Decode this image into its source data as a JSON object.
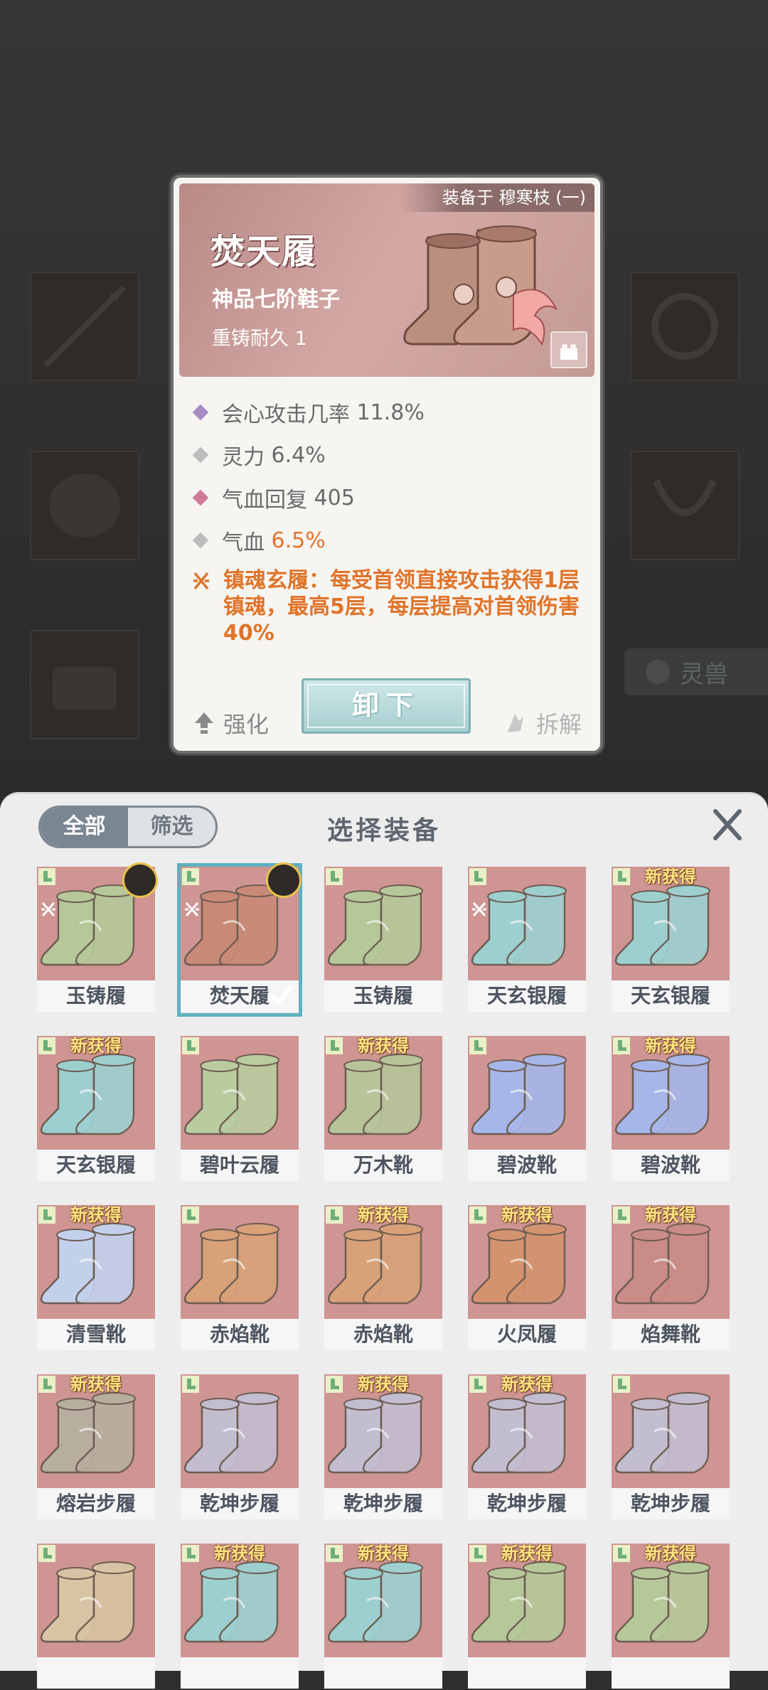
{
  "background": {
    "side_tab_label": "灵兽"
  },
  "detail": {
    "equipped_label": "装备于 穆寒枝 (一)",
    "name": "焚天履",
    "grade": "神品七阶鞋子",
    "reforge": "重铸耐久 1",
    "stats": [
      {
        "label": "会心攻击几率",
        "value": "11.8%",
        "diamond_color": "#a68ac4",
        "value_highlight": false
      },
      {
        "label": "灵力",
        "value": "6.4%",
        "diamond_color": "#bdbdbd",
        "value_highlight": false
      },
      {
        "label": "气血回复",
        "value": "405",
        "diamond_color": "#cf7b99",
        "value_highlight": false
      },
      {
        "label": "气血",
        "value": "6.5%",
        "diamond_color": "#bdbdbd",
        "value_highlight": true
      }
    ],
    "special_effect": "镇魂玄履：每受首领直接攻击获得1层镇魂，最高5层，每层提高对首领伤害40%",
    "enhance_label": "强化",
    "unequip_label": "卸下",
    "dismantle_label": "拆解"
  },
  "panel": {
    "title": "选择装备",
    "tabs": [
      {
        "label": "全部",
        "active": true
      },
      {
        "label": "筛选",
        "active": false
      }
    ],
    "new_badge": "新获得",
    "items": [
      {
        "name": "玉铸履",
        "is_new": false,
        "set_icon": true,
        "avatar": true,
        "selected": false,
        "tint": "#b6c89a"
      },
      {
        "name": "焚天履",
        "is_new": false,
        "set_icon": true,
        "avatar": true,
        "selected": true,
        "tint": "#c98a77"
      },
      {
        "name": "玉铸履",
        "is_new": false,
        "set_icon": false,
        "avatar": false,
        "selected": false,
        "tint": "#b6c89a"
      },
      {
        "name": "天玄银履",
        "is_new": false,
        "set_icon": true,
        "avatar": false,
        "selected": false,
        "tint": "#9ecfcf"
      },
      {
        "name": "天玄银履",
        "is_new": true,
        "set_icon": false,
        "avatar": false,
        "selected": false,
        "tint": "#9ecfcf"
      },
      {
        "name": "天玄银履",
        "is_new": true,
        "set_icon": false,
        "avatar": false,
        "selected": false,
        "tint": "#9ecfcf"
      },
      {
        "name": "碧叶云履",
        "is_new": false,
        "set_icon": false,
        "avatar": false,
        "selected": false,
        "tint": "#b9cc9f"
      },
      {
        "name": "万木靴",
        "is_new": true,
        "set_icon": false,
        "avatar": false,
        "selected": false,
        "tint": "#b7c49a"
      },
      {
        "name": "碧波靴",
        "is_new": false,
        "set_icon": false,
        "avatar": false,
        "selected": false,
        "tint": "#a6b6e8"
      },
      {
        "name": "碧波靴",
        "is_new": true,
        "set_icon": false,
        "avatar": false,
        "selected": false,
        "tint": "#a6b6e8"
      },
      {
        "name": "清雪靴",
        "is_new": true,
        "set_icon": false,
        "avatar": false,
        "selected": false,
        "tint": "#c2d0ec"
      },
      {
        "name": "赤焰靴",
        "is_new": false,
        "set_icon": false,
        "avatar": false,
        "selected": false,
        "tint": "#d8a178"
      },
      {
        "name": "赤焰靴",
        "is_new": true,
        "set_icon": false,
        "avatar": false,
        "selected": false,
        "tint": "#d8a178"
      },
      {
        "name": "火凤履",
        "is_new": true,
        "set_icon": false,
        "avatar": false,
        "selected": false,
        "tint": "#d4936f"
      },
      {
        "name": "焰舞靴",
        "is_new": true,
        "set_icon": false,
        "avatar": false,
        "selected": false,
        "tint": "#c98c86"
      },
      {
        "name": "熔岩步履",
        "is_new": true,
        "set_icon": false,
        "avatar": false,
        "selected": false,
        "tint": "#b7aea0"
      },
      {
        "name": "乾坤步履",
        "is_new": false,
        "set_icon": false,
        "avatar": false,
        "selected": false,
        "tint": "#c3bdd0"
      },
      {
        "name": "乾坤步履",
        "is_new": true,
        "set_icon": false,
        "avatar": false,
        "selected": false,
        "tint": "#c3bdd0"
      },
      {
        "name": "乾坤步履",
        "is_new": true,
        "set_icon": false,
        "avatar": false,
        "selected": false,
        "tint": "#c3bdd0"
      },
      {
        "name": "乾坤步履",
        "is_new": false,
        "set_icon": false,
        "avatar": false,
        "selected": false,
        "tint": "#c3bdd0"
      },
      {
        "name": "",
        "is_new": false,
        "set_icon": false,
        "avatar": false,
        "selected": false,
        "tint": "#d8c3a4"
      },
      {
        "name": "",
        "is_new": true,
        "set_icon": false,
        "avatar": false,
        "selected": false,
        "tint": "#9ecfcf"
      },
      {
        "name": "",
        "is_new": true,
        "set_icon": false,
        "avatar": false,
        "selected": false,
        "tint": "#9ecfcf"
      },
      {
        "name": "",
        "is_new": true,
        "set_icon": false,
        "avatar": false,
        "selected": false,
        "tint": "#b6c89a"
      },
      {
        "name": "",
        "is_new": true,
        "set_icon": false,
        "avatar": false,
        "selected": false,
        "tint": "#b6c89a"
      }
    ]
  },
  "colors": {
    "accent_orange": "#e0742a",
    "item_bg": "#cf9593",
    "new_badge": "#ffe483",
    "selected_border": "#5fb0c0"
  }
}
